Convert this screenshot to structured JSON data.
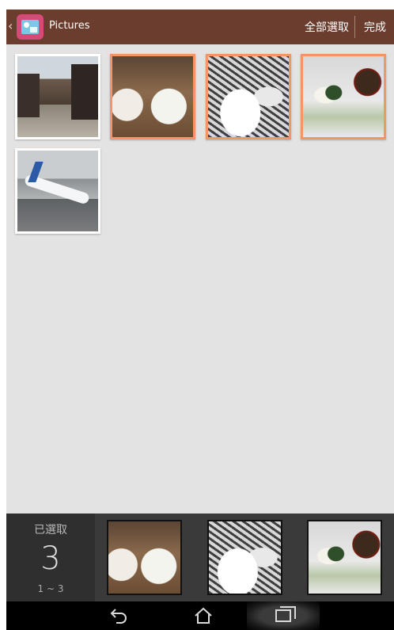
{
  "actionbar": {
    "title": "Pictures",
    "select_all_label": "全部選取",
    "done_label": "完成",
    "app_icon": "gallery-app-icon",
    "back_icon": "chevron-left-icon"
  },
  "grid": {
    "items": [
      {
        "name": "street-photo",
        "selected": false
      },
      {
        "name": "food-photo",
        "selected": true
      },
      {
        "name": "snow-village-photo",
        "selected": true
      },
      {
        "name": "sushi-meal-photo",
        "selected": true
      },
      {
        "name": "airplane-photo",
        "selected": false
      }
    ]
  },
  "tray": {
    "label": "已選取",
    "count": "3",
    "range": "1 ~ 3"
  },
  "navbar": {
    "back_icon": "back-arrow-icon",
    "home_icon": "home-icon",
    "recent_icon": "recent-apps-icon"
  },
  "colors": {
    "actionbar": "#6b3d2e",
    "selection_border": "#f39566",
    "background": "#e3e3e3",
    "tray": "#3a3a3a"
  }
}
